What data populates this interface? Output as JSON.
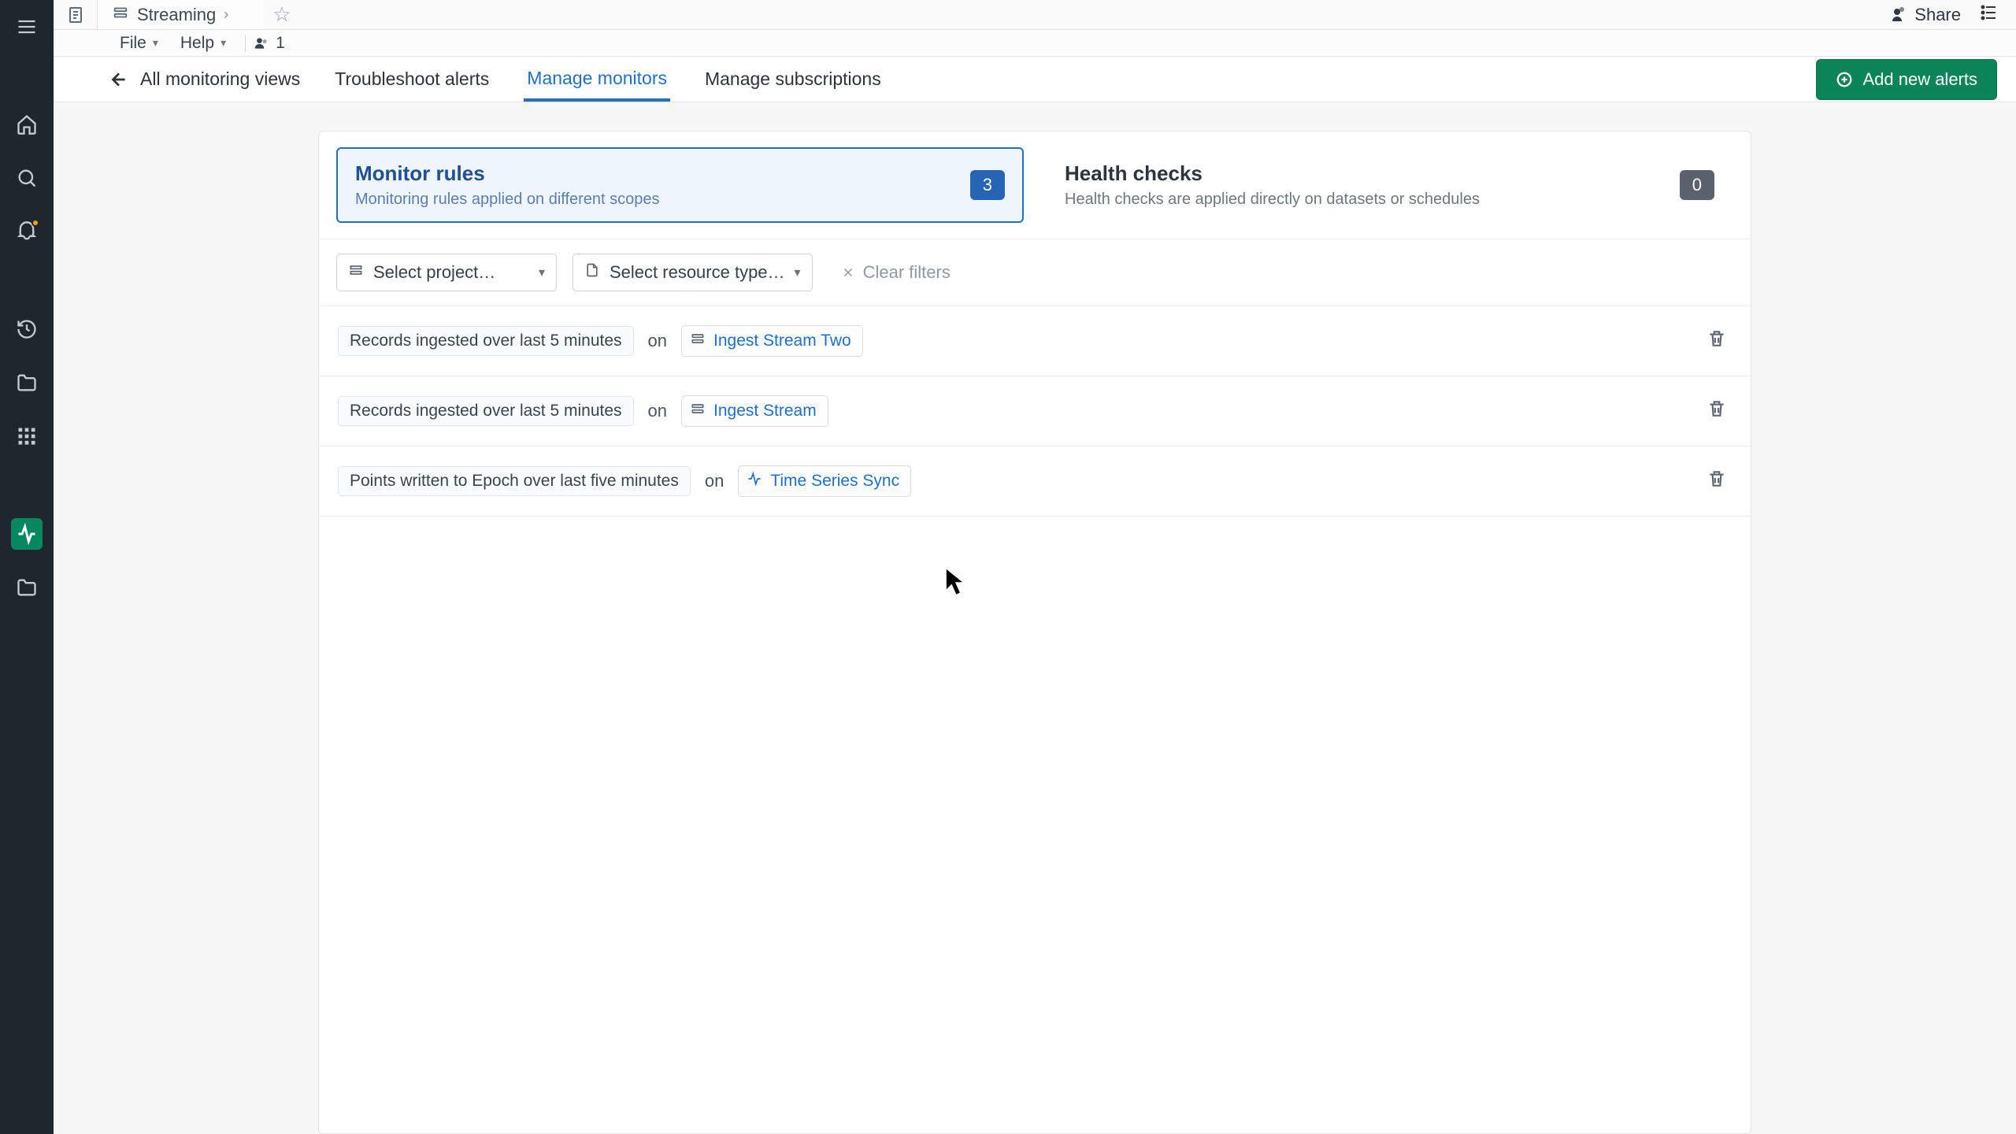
{
  "breadcrumb": {
    "title": "Streaming",
    "redacted": "                        "
  },
  "menubar": {
    "file": "File",
    "help": "Help",
    "user_count": "1"
  },
  "topbar": {
    "share": "Share"
  },
  "actionbar": {
    "back": "All monitoring views",
    "tabs": [
      "Troubleshoot alerts",
      "Manage monitors",
      "Manage subscriptions"
    ],
    "active_index": 1,
    "add_alerts": "Add new alerts"
  },
  "cards": {
    "monitor_rules": {
      "title": "Monitor rules",
      "subtitle": "Monitoring rules applied on different scopes",
      "count": "3"
    },
    "health_checks": {
      "title": "Health checks",
      "subtitle": "Health checks are applied directly on datasets or schedules",
      "count": "0"
    }
  },
  "filters": {
    "project_placeholder": "Select project…",
    "resource_placeholder": "Select resource type…",
    "clear": "Clear filters"
  },
  "rules": [
    {
      "label": "Records ingested over last 5 minutes",
      "on": "on",
      "resource": "Ingest Stream Two",
      "resource_type": "stream"
    },
    {
      "label": "Records ingested over last 5 minutes",
      "on": "on",
      "resource": "Ingest Stream",
      "resource_type": "stream"
    },
    {
      "label": "Points written to Epoch over last five minutes",
      "on": "on",
      "resource": "Time Series Sync",
      "resource_type": "sync"
    }
  ]
}
